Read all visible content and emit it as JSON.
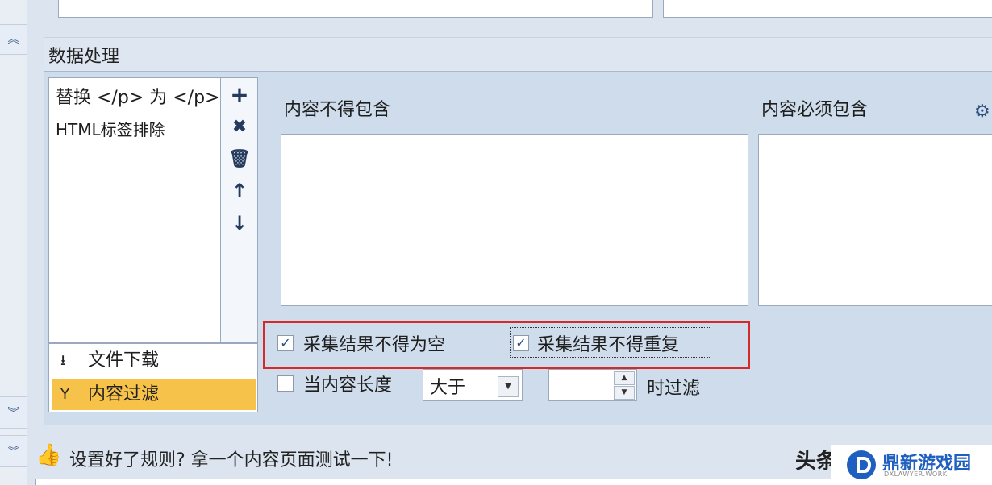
{
  "section": {
    "title": "数据处理"
  },
  "rules": {
    "items": [
      {
        "label": "替换 </p> 为 </p>"
      },
      {
        "label": "HTML标签排除"
      }
    ]
  },
  "modes": [
    {
      "label": "文件下载",
      "icon": "download-icon",
      "active": false
    },
    {
      "label": "内容过滤",
      "icon": "filter-icon",
      "active": true
    }
  ],
  "filter": {
    "exclude_label": "内容不得包含",
    "include_label": "内容必须包含",
    "not_empty_label": "采集结果不得为空",
    "not_empty_checked": true,
    "no_duplicate_label": "采集结果不得重复",
    "no_duplicate_checked": true,
    "length_label": "当内容长度",
    "length_checked": false,
    "length_op": "大于",
    "length_suffix": "时过滤"
  },
  "hint": {
    "text": "设置好了规则? 拿一个内容页面测试一下!"
  },
  "watermark": {
    "prefix": "头条",
    "site_name": "鼎新游戏园",
    "site_domain": "DXLAWYER.WORK"
  },
  "colors": {
    "highlight": "#f6c24a",
    "red_outline": "#d42a2a",
    "accent": "#1f5fbf"
  }
}
